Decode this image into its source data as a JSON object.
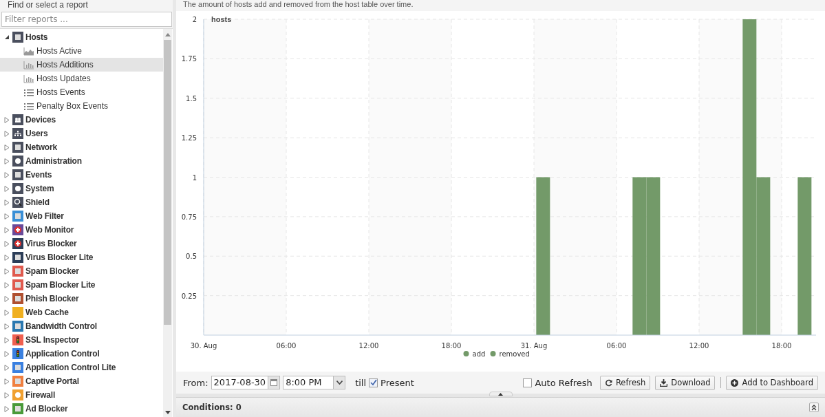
{
  "sidebar": {
    "title": "Find or select a report",
    "filter": {
      "placeholder": "Filter reports ..."
    },
    "tree": [
      {
        "label": "Hosts",
        "expanded": true,
        "selected": false,
        "children": [
          {
            "label": "Hosts Active",
            "kind": "area",
            "selected": false
          },
          {
            "label": "Hosts Additions",
            "kind": "bar",
            "selected": true
          },
          {
            "label": "Hosts Updates",
            "kind": "bar",
            "selected": false
          },
          {
            "label": "Hosts Events",
            "kind": "list",
            "selected": false
          },
          {
            "label": "Penalty Box Events",
            "kind": "list",
            "selected": false
          }
        ]
      },
      {
        "label": "Devices",
        "expanded": false,
        "selected": false
      },
      {
        "label": "Users",
        "expanded": false,
        "selected": false
      },
      {
        "label": "Network",
        "expanded": false,
        "selected": false
      },
      {
        "label": "Administration",
        "expanded": false,
        "selected": false
      },
      {
        "label": "Events",
        "expanded": false,
        "selected": false
      },
      {
        "label": "System",
        "expanded": false,
        "selected": false
      },
      {
        "label": "Shield",
        "expanded": false,
        "selected": false
      },
      {
        "label": "Web Filter",
        "expanded": false,
        "selected": false
      },
      {
        "label": "Web Monitor",
        "expanded": false,
        "selected": false
      },
      {
        "label": "Virus Blocker",
        "expanded": false,
        "selected": false
      },
      {
        "label": "Virus Blocker Lite",
        "expanded": false,
        "selected": false
      },
      {
        "label": "Spam Blocker",
        "expanded": false,
        "selected": false
      },
      {
        "label": "Spam Blocker Lite",
        "expanded": false,
        "selected": false
      },
      {
        "label": "Phish Blocker",
        "expanded": false,
        "selected": false
      },
      {
        "label": "Web Cache",
        "expanded": false,
        "selected": false
      },
      {
        "label": "Bandwidth Control",
        "expanded": false,
        "selected": false
      },
      {
        "label": "SSL Inspector",
        "expanded": false,
        "selected": false
      },
      {
        "label": "Application Control",
        "expanded": false,
        "selected": false
      },
      {
        "label": "Application Control Lite",
        "expanded": false,
        "selected": false
      },
      {
        "label": "Captive Portal",
        "expanded": false,
        "selected": false
      },
      {
        "label": "Firewall",
        "expanded": false,
        "selected": false
      },
      {
        "label": "Ad Blocker",
        "expanded": false,
        "selected": false
      }
    ]
  },
  "report": {
    "description": "The amount of hosts add and removed from the host table over time.",
    "chart_data": {
      "type": "bar",
      "ylabel": "hosts",
      "x": [
        "2017-08-31T00:40",
        "2017-08-31T07:40",
        "2017-08-31T08:40",
        "2017-08-31T15:40",
        "2017-08-31T16:40",
        "2017-08-31T19:40"
      ],
      "series": [
        {
          "name": "add",
          "color": "#739a69",
          "values": [
            1,
            1,
            1,
            2,
            1,
            1
          ]
        },
        {
          "name": "removed",
          "color": "#739a69",
          "values": [
            0,
            0,
            0,
            0,
            0,
            0
          ]
        }
      ],
      "xlim": [
        "2017-08-30T00:00",
        "2017-08-31T20:30"
      ],
      "ylim": [
        0,
        2
      ],
      "grid": true,
      "xticks": [
        {
          "value": "2017-08-30T00:00",
          "label": "30. Aug"
        },
        {
          "value": "2017-08-30T06:00",
          "label": "06:00"
        },
        {
          "value": "2017-08-30T12:00",
          "label": "12:00"
        },
        {
          "value": "2017-08-30T18:00",
          "label": "18:00"
        },
        {
          "value": "2017-08-31T00:00",
          "label": "31. Aug"
        },
        {
          "value": "2017-08-31T06:00",
          "label": "06:00"
        },
        {
          "value": "2017-08-31T12:00",
          "label": "12:00"
        },
        {
          "value": "2017-08-31T18:00",
          "label": "18:00"
        }
      ],
      "yticks": [
        {
          "value": 0.25,
          "label": "0.25"
        },
        {
          "value": 0.5,
          "label": "0.5"
        },
        {
          "value": 0.75,
          "label": "0.75"
        },
        {
          "value": 1,
          "label": "1"
        },
        {
          "value": 1.25,
          "label": "1.25"
        },
        {
          "value": 1.5,
          "label": "1.5"
        },
        {
          "value": 1.75,
          "label": "1.75"
        },
        {
          "value": 2,
          "label": "2"
        }
      ]
    },
    "toolbar": {
      "from_label": "From:",
      "date": "2017-08-30",
      "time": "8:00 PM",
      "till_label": "till",
      "present": {
        "label": "Present",
        "checked": true
      },
      "auto_refresh": {
        "label": "Auto Refresh",
        "checked": false
      },
      "buttons": [
        {
          "label": "Refresh",
          "kind": "refresh"
        },
        {
          "label": "Download",
          "kind": "download"
        },
        {
          "label": "Add to Dashboard",
          "kind": "add"
        }
      ]
    },
    "conditions": {
      "title": "Conditions: 0"
    }
  }
}
